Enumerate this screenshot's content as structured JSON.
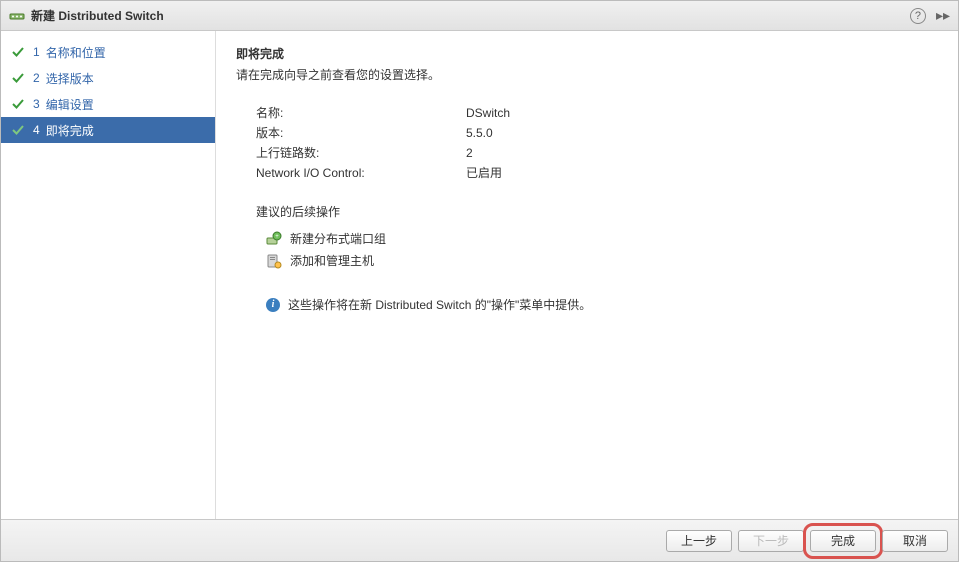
{
  "titlebar": {
    "title": "新建 Distributed Switch"
  },
  "steps": [
    {
      "num": "1",
      "label": "名称和位置"
    },
    {
      "num": "2",
      "label": "选择版本"
    },
    {
      "num": "3",
      "label": "编辑设置"
    },
    {
      "num": "4",
      "label": "即将完成"
    }
  ],
  "content": {
    "heading": "即将完成",
    "subheading": "请在完成向导之前查看您的设置选择。",
    "summary": [
      {
        "key": "名称:",
        "val": "DSwitch"
      },
      {
        "key": "版本:",
        "val": "5.5.0"
      },
      {
        "key": "上行链路数:",
        "val": "2"
      },
      {
        "key": "Network I/O Control:",
        "val": "已启用"
      }
    ],
    "suggest_title": "建议的后续操作",
    "suggest_items": [
      "新建分布式端口组",
      "添加和管理主机"
    ],
    "info_text": "这些操作将在新 Distributed Switch 的\"操作\"菜单中提供。"
  },
  "footer": {
    "back": "上一步",
    "next": "下一步",
    "finish": "完成",
    "cancel": "取消"
  }
}
